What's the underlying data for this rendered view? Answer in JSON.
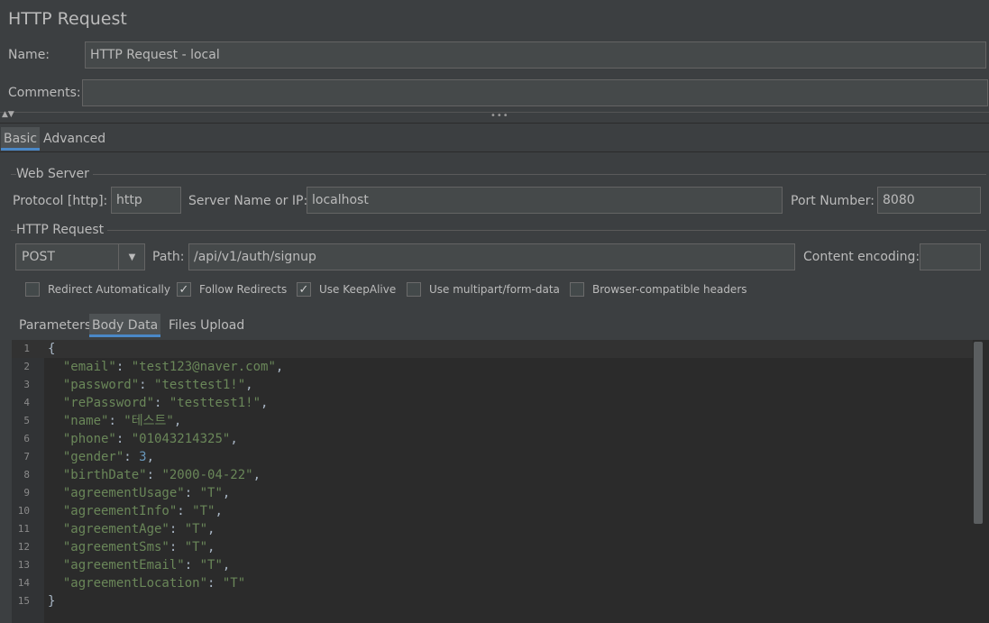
{
  "window": {
    "title": "HTTP Request"
  },
  "form": {
    "name_label": "Name:",
    "name_value": "HTTP Request - local",
    "comments_label": "Comments:",
    "comments_value": ""
  },
  "tabs": [
    {
      "label": "Basic",
      "active": true
    },
    {
      "label": "Advanced",
      "active": false
    }
  ],
  "web_server": {
    "group_title": "Web Server",
    "protocol_label": "Protocol [http]:",
    "protocol_value": "http",
    "server_label": "Server Name or IP:",
    "server_value": "localhost",
    "port_label": "Port Number:",
    "port_value": "8080"
  },
  "http_request": {
    "group_title": "HTTP Request",
    "method_value": "POST",
    "path_label": "Path:",
    "path_value": "/api/v1/auth/signup",
    "encoding_label": "Content encoding:",
    "encoding_value": ""
  },
  "checkboxes": [
    {
      "label": "Redirect Automatically",
      "checked": false
    },
    {
      "label": "Follow Redirects",
      "checked": true
    },
    {
      "label": "Use KeepAlive",
      "checked": true
    },
    {
      "label": "Use multipart/form-data",
      "checked": false
    },
    {
      "label": "Browser-compatible headers",
      "checked": false
    }
  ],
  "body_tabs": [
    {
      "label": "Parameters",
      "active": false
    },
    {
      "label": "Body Data",
      "active": true
    },
    {
      "label": "Files Upload",
      "active": false
    }
  ],
  "body_lines": [
    {
      "num": "1",
      "text": "{"
    },
    {
      "num": "2",
      "text": "  \"email\": \"test123@naver.com\","
    },
    {
      "num": "3",
      "text": "  \"password\": \"testtest1!\","
    },
    {
      "num": "4",
      "text": "  \"rePassword\": \"testtest1!\","
    },
    {
      "num": "5",
      "text": "  \"name\": \"테스트\","
    },
    {
      "num": "6",
      "text": "  \"phone\": \"01043214325\","
    },
    {
      "num": "7",
      "text": "  \"gender\": 3,"
    },
    {
      "num": "8",
      "text": "  \"birthDate\": \"2000-04-22\","
    },
    {
      "num": "9",
      "text": "  \"agreementUsage\": \"T\","
    },
    {
      "num": "10",
      "text": "  \"agreementInfo\": \"T\","
    },
    {
      "num": "11",
      "text": "  \"agreementAge\": \"T\","
    },
    {
      "num": "12",
      "text": "  \"agreementSms\": \"T\","
    },
    {
      "num": "13",
      "text": "  \"agreementEmail\": \"T\","
    },
    {
      "num": "14",
      "text": "  \"agreementLocation\": \"T\""
    },
    {
      "num": "15",
      "text": "}"
    }
  ],
  "icons": {
    "collapse": "arrows-up-down-icon",
    "splitter": "drag-handle-icon",
    "dropdown": "chevron-down-icon",
    "check": "checkmark-icon"
  },
  "colors": {
    "background": "#3c3f41",
    "field": "#45494a",
    "editor": "#2b2b2b",
    "string": "#6a8759",
    "number": "#6897bb",
    "accent": "#4a88c7"
  }
}
